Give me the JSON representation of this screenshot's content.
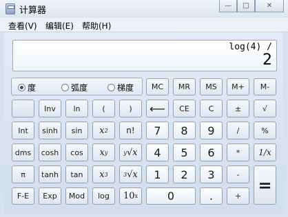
{
  "window": {
    "title": "计算器",
    "min_glyph": "—",
    "max_glyph": "□",
    "close_glyph": "✕"
  },
  "menu": [
    "查看(V)",
    "编辑(E)",
    "帮助(H)"
  ],
  "display": {
    "expression": "log(4) /",
    "value": "2"
  },
  "angle": {
    "options": [
      "度",
      "弧度",
      "梯度"
    ],
    "selected": "度"
  },
  "memory": [
    "MC",
    "MR",
    "MS",
    "M+",
    "M-"
  ],
  "keys": {
    "inv": "Inv",
    "ln": "ln",
    "lparen": "(",
    "rparen": ")",
    "backspace": "⟵",
    "ce": "CE",
    "c": "C",
    "plusminus": "±",
    "sqrt": "√",
    "int": "Int",
    "sinh": "sinh",
    "sin": "sin",
    "x2_base": "x",
    "x2_exp": "2",
    "fact": "n!",
    "n7": "7",
    "n8": "8",
    "n9": "9",
    "div": "/",
    "pct": "%",
    "dms": "dms",
    "cosh": "cosh",
    "cos": "cos",
    "xy_base": "x",
    "xy_exp": "y",
    "yroot_idx": "y",
    "yroot": "√x",
    "n4": "4",
    "n5": "5",
    "n6": "6",
    "mul": "*",
    "recip": "1/x",
    "pi": "π",
    "tanh": "tanh",
    "tan": "tan",
    "x3_base": "x",
    "x3_exp": "3",
    "croot_idx": "3",
    "croot": "√x",
    "n1": "1",
    "n2": "2",
    "n3": "3",
    "sub": "-",
    "eq": "=",
    "fe": "F-E",
    "exp": "Exp",
    "mod": "Mod",
    "log": "log",
    "tenx_base": "10",
    "tenx_exp": "x",
    "n0": "0",
    "dot": ".",
    "add": "+"
  }
}
